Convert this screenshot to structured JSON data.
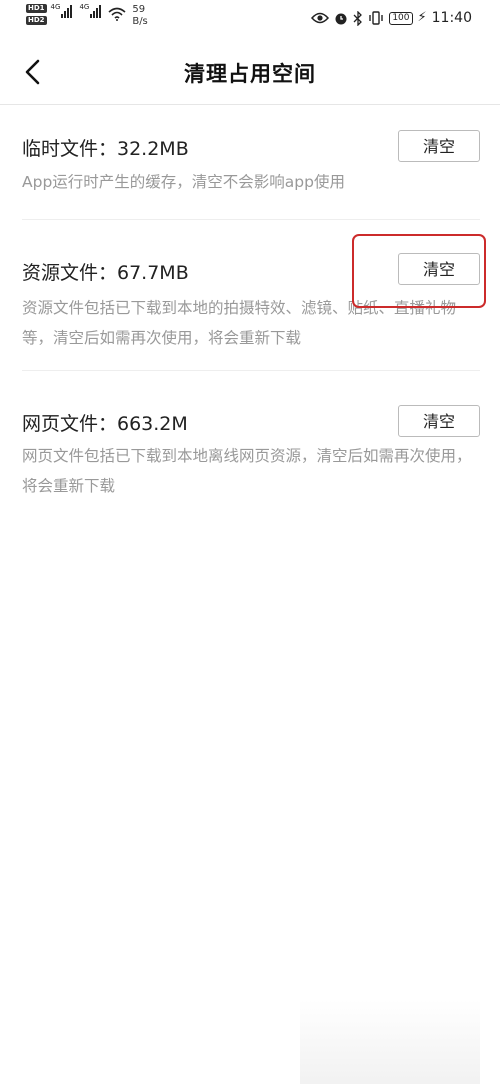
{
  "status_bar": {
    "sim1_badge": "HD1",
    "sim2_badge": "HD2",
    "network1": "4G",
    "network2": "4G",
    "speed_value": "59",
    "speed_unit": "B/s",
    "battery": "100",
    "time": "11:40"
  },
  "header": {
    "back_icon": "chevron-left-icon",
    "title": "清理占用空间"
  },
  "sections": [
    {
      "title": "临时文件：32.2MB",
      "description": "App运行时产生的缓存，清空不会影响app使用",
      "button_label": "清空"
    },
    {
      "title": "资源文件：67.7MB",
      "description": "资源文件包括已下载到本地的拍摄特效、滤镜、贴纸、直播礼物等，清空后如需再次使用，将会重新下载",
      "button_label": "清空"
    },
    {
      "title": "网页文件：663.2M",
      "description": "网页文件包括已下载到本地离线网页资源，清空后如需再次使用，将会重新下载",
      "button_label": "清空"
    }
  ],
  "colors": {
    "highlight": "#cc2b2b",
    "description_text": "#999999",
    "divider": "#eeeeee"
  }
}
